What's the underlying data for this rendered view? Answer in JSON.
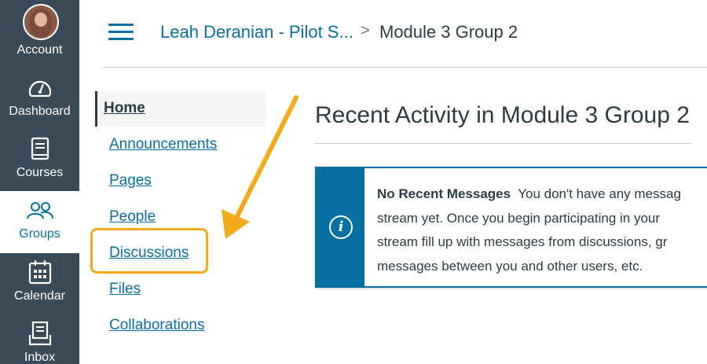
{
  "global_nav": {
    "account": "Account",
    "dashboard": "Dashboard",
    "courses": "Courses",
    "groups": "Groups",
    "calendar": "Calendar",
    "inbox": "Inbox"
  },
  "breadcrumb": {
    "course": "Leah Deranian - Pilot S...",
    "separator": ">",
    "group": "Module 3 Group 2"
  },
  "course_nav": {
    "items": [
      "Home",
      "Announcements",
      "Pages",
      "People",
      "Discussions",
      "Files",
      "Collaborations"
    ],
    "active": "Home",
    "highlighted": "Discussions"
  },
  "main": {
    "title": "Recent Activity in Module 3 Group 2",
    "alert": {
      "icon": "info-icon",
      "title": "No Recent Messages",
      "lines": [
        "You don't have any messag",
        "stream yet. Once you begin participating in your",
        "stream fill up with messages from discussions, gr",
        "messages between you and other users, etc."
      ]
    }
  },
  "colors": {
    "nav_bg": "#394b58",
    "link": "#0770a3",
    "highlight": "#f4ab1a",
    "text": "#2d3b45"
  }
}
